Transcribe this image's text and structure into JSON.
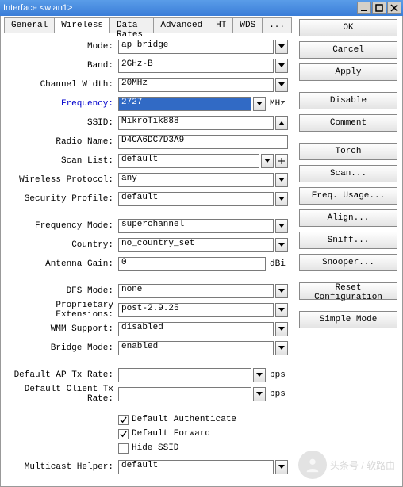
{
  "window": {
    "title": "Interface <wlan1>"
  },
  "tabs": {
    "items": [
      "General",
      "Wireless",
      "Data Rates",
      "Advanced",
      "HT",
      "WDS",
      "..."
    ],
    "active": 1
  },
  "form": {
    "mode": {
      "label": "Mode:",
      "value": "ap bridge"
    },
    "band": {
      "label": "Band:",
      "value": "2GHz-B"
    },
    "channel_width": {
      "label": "Channel Width:",
      "value": "20MHz"
    },
    "frequency": {
      "label": "Frequency:",
      "value": "2727",
      "unit": "MHz"
    },
    "ssid": {
      "label": "SSID:",
      "value": "MikroTik888"
    },
    "radio_name": {
      "label": "Radio Name:",
      "value": "D4CA6DC7D3A9"
    },
    "scan_list": {
      "label": "Scan List:",
      "value": "default"
    },
    "wireless_protocol": {
      "label": "Wireless Protocol:",
      "value": "any"
    },
    "security_profile": {
      "label": "Security Profile:",
      "value": "default"
    },
    "frequency_mode": {
      "label": "Frequency Mode:",
      "value": "superchannel"
    },
    "country": {
      "label": "Country:",
      "value": "no_country_set"
    },
    "antenna_gain": {
      "label": "Antenna Gain:",
      "value": "0",
      "unit": "dBi"
    },
    "dfs_mode": {
      "label": "DFS Mode:",
      "value": "none"
    },
    "proprietary_ext": {
      "label": "Proprietary Extensions:",
      "value": "post-2.9.25"
    },
    "wmm_support": {
      "label": "WMM Support:",
      "value": "disabled"
    },
    "bridge_mode": {
      "label": "Bridge Mode:",
      "value": "enabled"
    },
    "default_ap_tx": {
      "label": "Default AP Tx Rate:",
      "value": "",
      "unit": "bps"
    },
    "default_client_tx": {
      "label": "Default Client Tx Rate:",
      "value": "",
      "unit": "bps"
    },
    "default_auth": {
      "label": "Default Authenticate",
      "checked": true
    },
    "default_fwd": {
      "label": "Default Forward",
      "checked": true
    },
    "hide_ssid": {
      "label": "Hide SSID",
      "checked": false
    },
    "multicast_helper": {
      "label": "Multicast Helper:",
      "value": "default"
    }
  },
  "buttons": {
    "ok": "OK",
    "cancel": "Cancel",
    "apply": "Apply",
    "disable": "Disable",
    "comment": "Comment",
    "torch": "Torch",
    "scan": "Scan...",
    "freq_usage": "Freq. Usage...",
    "align": "Align...",
    "sniff": "Sniff...",
    "snooper": "Snooper...",
    "reset": "Reset Configuration",
    "simple": "Simple Mode"
  },
  "watermark": {
    "text": "头条号 / 软路由"
  }
}
